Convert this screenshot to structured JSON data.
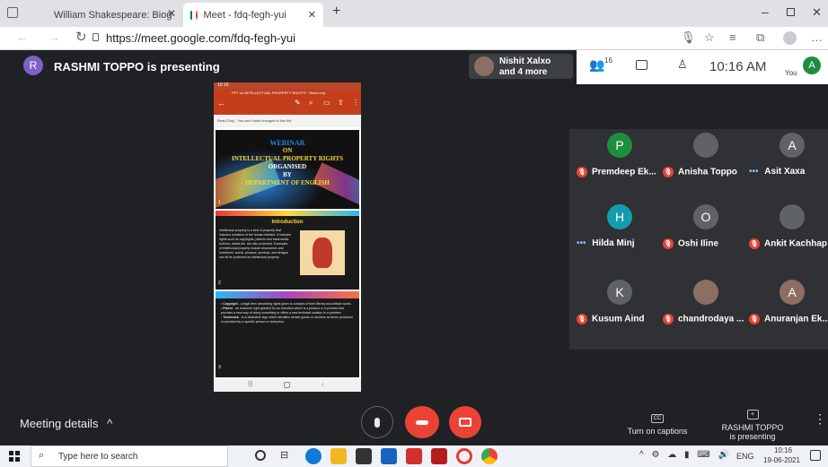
{
  "browser": {
    "tabs": [
      {
        "title": "William Shakespeare: Biography"
      },
      {
        "title": "Meet - fdq-fegh-yui"
      }
    ],
    "url": "https://meet.google.com/fdq-fegh-yui"
  },
  "meet": {
    "presenting_label": "RASHMI TOPPO is presenting",
    "presenter_initial": "R",
    "others_label": "Nishit Xalxo",
    "others_count": "and 4 more",
    "participants_count": "16",
    "time": "10:16 AM",
    "you_label": "You",
    "you_initial": "A",
    "tiles": [
      {
        "name": "Premdeep Ek...",
        "initial": "P",
        "color": "#1e8e3e",
        "status": "muted"
      },
      {
        "name": "Anisha Toppo",
        "initial": "",
        "color": "#5f6368",
        "status": "muted"
      },
      {
        "name": "Asit Xaxa",
        "initial": "A",
        "color": "#5f6368",
        "status": "speaking"
      },
      {
        "name": "Hilda Minj",
        "initial": "H",
        "color": "#129eaf",
        "status": "speaking"
      },
      {
        "name": "Oshi Iline",
        "initial": "O",
        "color": "#5f6368",
        "status": "muted"
      },
      {
        "name": "Ankit Kachhap",
        "initial": "",
        "color": "#5f6368",
        "status": "muted"
      },
      {
        "name": "Kusum Aind",
        "initial": "K",
        "color": "#5f6368",
        "status": "muted"
      },
      {
        "name": "chandrodaya ...",
        "initial": "",
        "color": "#8d6e63",
        "status": "muted"
      },
      {
        "name": "Anuranjan Ek...",
        "initial": "A",
        "color": "#8d6e63",
        "status": "muted"
      }
    ]
  },
  "shared_doc": {
    "status_time": "10:16",
    "doc_title": "PPT on INTELLECTUAL PROPERTY RIGHTS · Read only",
    "read_only_notice": "Read Only - You can't save changes to this file.",
    "slide1": {
      "line1": "WEBINAR",
      "line2": "ON",
      "line3": "INTELLECTUAL PROPERTY RIGHTS",
      "line4": "ORGANISED",
      "line5": "BY",
      "line6": "DEPARTMENT OF ENGLISH",
      "num": "1"
    },
    "slide2": {
      "title": "Introduction",
      "body": "Intellectual property is a kind of property that includes creations of the human intellect. It includes rights such as copyrights, patents and trademarks. Authors, artists etc. are also protected. Examples of intellectual property include discoveries and inventions, words, phrases, symbols, and designs can all be protected as intellectual property.",
      "num": "2"
    },
    "slide3": {
      "bullet1_title": "Copyright",
      "bullet1": " - a legal term describing rights given to creators of their literary and artistic works.",
      "bullet2_title": "Patent",
      "bullet2": " - an exclusive right granted for an invention which is a product or a process that provides a new way of doing something or offers a new technical solution to a problem.",
      "bullet3_title": "Trademark",
      "bullet3": " - is a distinctive sign which identifies certain goods or services as those produced or provided by a specific person or enterprise.",
      "num": "3"
    }
  },
  "bottom": {
    "meeting_details": "Meeting details",
    "captions_label": "Turn on captions",
    "cc_icon_text": "CC",
    "presenting_line1": "RASHMI TOPPO",
    "presenting_line2": "is presenting"
  },
  "taskbar": {
    "search_placeholder": "Type here to search",
    "lang": "ENG",
    "clock_time": "10:16",
    "clock_date": "19-06-2021"
  },
  "colors": {
    "meet_bg": "#202124",
    "hangup": "#ea4335",
    "muted": "#ea4335",
    "accent_blue": "#8ab4f8"
  }
}
